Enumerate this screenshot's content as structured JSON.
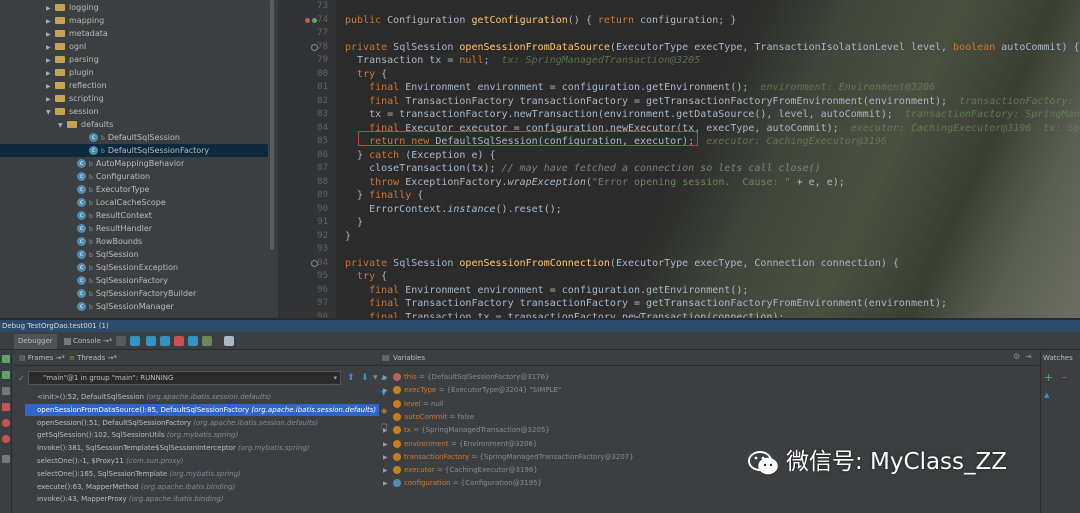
{
  "tree": {
    "items": [
      {
        "label": "logging",
        "type": "folder",
        "indent": 46,
        "arrow": "▶"
      },
      {
        "label": "mapping",
        "type": "folder",
        "indent": 46,
        "arrow": "▶"
      },
      {
        "label": "metadata",
        "type": "folder",
        "indent": 46,
        "arrow": "▶"
      },
      {
        "label": "ognl",
        "type": "folder",
        "indent": 46,
        "arrow": "▶"
      },
      {
        "label": "parsing",
        "type": "folder",
        "indent": 46,
        "arrow": "▶"
      },
      {
        "label": "plugin",
        "type": "folder",
        "indent": 46,
        "arrow": "▶"
      },
      {
        "label": "reflection",
        "type": "folder",
        "indent": 46,
        "arrow": "▶"
      },
      {
        "label": "scripting",
        "type": "folder",
        "indent": 46,
        "arrow": "▶"
      },
      {
        "label": "session",
        "type": "folder",
        "indent": 46,
        "arrow": "▼"
      },
      {
        "label": "defaults",
        "type": "folder",
        "indent": 58,
        "arrow": "▼"
      },
      {
        "label": "DefaultSqlSession",
        "type": "class",
        "indent": 80,
        "arrow": ""
      },
      {
        "label": "DefaultSqlSessionFactory",
        "type": "class",
        "indent": 80,
        "arrow": "",
        "selected": true
      },
      {
        "label": "AutoMappingBehavior",
        "type": "class",
        "indent": 68,
        "arrow": ""
      },
      {
        "label": "Configuration",
        "type": "class",
        "indent": 68,
        "arrow": ""
      },
      {
        "label": "ExecutorType",
        "type": "class",
        "indent": 68,
        "arrow": ""
      },
      {
        "label": "LocalCacheScope",
        "type": "class",
        "indent": 68,
        "arrow": ""
      },
      {
        "label": "ResultContext",
        "type": "class",
        "indent": 68,
        "arrow": ""
      },
      {
        "label": "ResultHandler",
        "type": "class",
        "indent": 68,
        "arrow": ""
      },
      {
        "label": "RowBounds",
        "type": "class",
        "indent": 68,
        "arrow": ""
      },
      {
        "label": "SqlSession",
        "type": "class",
        "indent": 68,
        "arrow": ""
      },
      {
        "label": "SqlSessionException",
        "type": "class",
        "indent": 68,
        "arrow": ""
      },
      {
        "label": "SqlSessionFactory",
        "type": "class",
        "indent": 68,
        "arrow": ""
      },
      {
        "label": "SqlSessionFactoryBuilder",
        "type": "class",
        "indent": 68,
        "arrow": ""
      },
      {
        "label": "SqlSessionManager",
        "type": "class",
        "indent": 68,
        "arrow": ""
      }
    ]
  },
  "editor": {
    "lines": [
      {
        "n": "73",
        "html": ""
      },
      {
        "n": "74",
        "mark": "override",
        "html": "<span class='kw'>public</span> Configuration <span class='fn'>getConfiguration</span>() { <span class='kw'>return</span> configuration; }"
      },
      {
        "n": "77",
        "html": ""
      },
      {
        "n": "78",
        "mark": "at",
        "html": "<span class='kw'>private</span> SqlSession <span class='fn'>openSessionFromDataSource</span>(ExecutorType execType, TransactionIsolationLevel level, <span class='kw'>boolean</span> autoCommit) {"
      },
      {
        "n": "79",
        "html": "  Transaction tx = <span class='kw'>null</span>;  <span class='inl'>tx: SpringManagedTransaction@3205</span>"
      },
      {
        "n": "80",
        "html": "  <span class='kw'>try</span> {"
      },
      {
        "n": "81",
        "html": "    <span class='kw'>final</span> Environment environment = configuration.getEnvironment();  <span class='inl'>environment: Environment@3206</span>"
      },
      {
        "n": "82",
        "html": "    <span class='kw'>final</span> TransactionFactory transactionFactory = getTransactionFactoryFromEnvironment(environment);  <span class='inl'>transactionFactory: SpringManaged</span>"
      },
      {
        "n": "83",
        "html": "    tx = transactionFactory.newTransaction(environment.getDataSource(), level, autoCommit);  <span class='inl'>transactionFactory: SpringManaged</span>"
      },
      {
        "n": "84",
        "html": "    <span class='kw'>final</span> Executor executor = configuration.newExecutor(tx, execType, autoCommit);  <span class='inl'>executor: CachingExecutor@3196  tx: Sp</span>"
      },
      {
        "n": "85",
        "html": "    <span class='kw'>return new</span> DefaultSqlSession(configuration, executor);  <span class='inl'>executor: CachingExecutor@3196</span>"
      },
      {
        "n": "86",
        "html": "  } <span class='kw'>catch</span> (Exception e) {"
      },
      {
        "n": "87",
        "html": "    closeTransaction(tx); <span class='cm'>// may have fetched a connection so lets call close()</span>"
      },
      {
        "n": "88",
        "html": "    <span class='kw'>throw</span> ExceptionFactory.<span class='it'>wrapException</span>(<span class='str'>\"Error opening session.  Cause: \"</span> + e, e);"
      },
      {
        "n": "89",
        "html": "  } <span class='kw'>finally</span> {"
      },
      {
        "n": "90",
        "html": "    ErrorContext.<span class='it'>instance</span>().reset();"
      },
      {
        "n": "91",
        "html": "  }"
      },
      {
        "n": "92",
        "html": "}"
      },
      {
        "n": "93",
        "html": ""
      },
      {
        "n": "94",
        "mark": "at",
        "html": "<span class='kw'>private</span> SqlSession <span class='fn'>openSessionFromConnection</span>(ExecutorType execType, Connection connection) {"
      },
      {
        "n": "95",
        "html": "  <span class='kw'>try</span> {"
      },
      {
        "n": "96",
        "html": "    <span class='kw'>final</span> Environment environment = configuration.getEnvironment();"
      },
      {
        "n": "97",
        "html": "    <span class='kw'>final</span> TransactionFactory transactionFactory = getTransactionFactoryFromEnvironment(environment);"
      },
      {
        "n": "98",
        "html": "    <span class='kw'>final</span> Transaction tx = transactionFactory.newTransaction(connection);"
      }
    ]
  },
  "debug": {
    "title": "Debug  TestOrgDao.test001 (1)",
    "tabs": {
      "debugger": "Debugger",
      "console": "Console",
      "threads": "Threads"
    },
    "frames_label": "Frames",
    "variables_label": "Variables",
    "watches_label": "Watches",
    "thread": "\"main\"@1 in group \"main\": RUNNING",
    "frames": [
      {
        "method": "<init>():52, DefaultSqlSession",
        "pkg": "(org.apache.ibatis.session.defaults)"
      },
      {
        "method": "openSessionFromDataSource():85, DefaultSqlSessionFactory",
        "pkg": "(org.apache.ibatis.session.defaults)",
        "selected": true
      },
      {
        "method": "openSession():51, DefaultSqlSessionFactory",
        "pkg": "(org.apache.ibatis.session.defaults)"
      },
      {
        "method": "getSqlSession():102, SqlSessionUtils",
        "pkg": "(org.mybatis.spring)"
      },
      {
        "method": "invoke():381, SqlSessionTemplate$SqlSessionInterceptor",
        "pkg": "(org.mybatis.spring)"
      },
      {
        "method": "selectOne():-1, $Proxy11",
        "pkg": "(com.sun.proxy)"
      },
      {
        "method": "selectOne():165, SqlSessionTemplate",
        "pkg": "(org.mybatis.spring)"
      },
      {
        "method": "execute():63, MapperMethod",
        "pkg": "(org.apache.ibatis.binding)"
      },
      {
        "method": "invoke():43, MapperProxy",
        "pkg": "(org.apache.ibatis.binding)"
      }
    ],
    "variables": [
      {
        "name": "this",
        "value": "= {DefaultSqlSessionFactory@3176}",
        "exp": true,
        "color": "#c15a5a"
      },
      {
        "name": "execType",
        "value": "= {ExecutorType@3204} \"SIMPLE\"",
        "exp": true,
        "color": "#c77d1e"
      },
      {
        "name": "level",
        "value": "= null",
        "exp": false,
        "color": "#c77d1e"
      },
      {
        "name": "autoCommit",
        "value": "= false",
        "exp": false,
        "color": "#c77d1e"
      },
      {
        "name": "tx",
        "value": "= {SpringManagedTransaction@3205}",
        "exp": true,
        "color": "#c77d1e"
      },
      {
        "name": "environment",
        "value": "= {Environment@3206}",
        "exp": true,
        "color": "#c77d1e"
      },
      {
        "name": "transactionFactory",
        "value": "= {SpringManagedTransactionFactory@3207}",
        "exp": true,
        "color": "#c77d1e"
      },
      {
        "name": "executor",
        "value": "= {CachingExecutor@3196}",
        "exp": true,
        "color": "#c77d1e"
      },
      {
        "name": "configuration",
        "value": "= {Configuration@3195}",
        "exp": true,
        "color": "#4e8db0"
      }
    ]
  },
  "watermark": {
    "text": "微信号: MyClass_ZZ",
    "icon": "wechat-icon"
  }
}
